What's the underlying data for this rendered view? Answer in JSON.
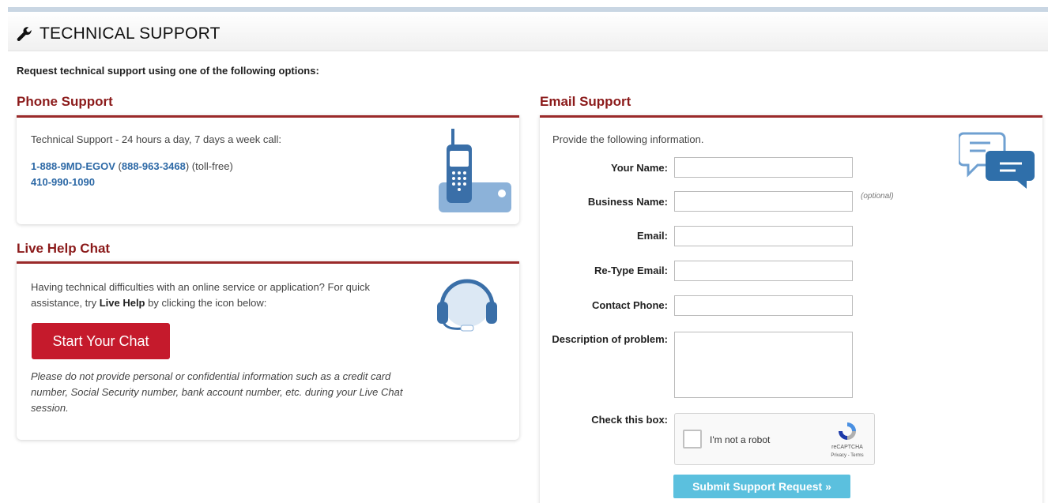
{
  "header": {
    "title": "TECHNICAL SUPPORT",
    "icon": "wrench-icon"
  },
  "intro": "Request technical support using one of the following options:",
  "phone": {
    "title": "Phone Support",
    "line1": "Technical Support - 24 hours a day, 7 days a week call:",
    "vanity_number": "1-888-9MD-EGOV",
    "paren_open": " (",
    "numeric_number": "888-963-3468",
    "paren_close": ")",
    "tollfree": " (toll-free)",
    "local_number": "410-990-1090",
    "icon": "phone-icon"
  },
  "chat": {
    "title": "Live Help Chat",
    "desc_before": "Having technical difficulties with an online service or application? For quick assistance, try ",
    "desc_bold": "Live Help",
    "desc_after": " by clicking the icon below:",
    "button": "Start Your Chat",
    "note": "Please do not provide personal or confidential information such as a credit card number, Social Security number, bank account number, etc. during your Live Chat session.",
    "icon": "headset-icon"
  },
  "email": {
    "title": "Email Support",
    "lead": "Provide the following information.",
    "labels": {
      "name": "Your Name:",
      "business": "Business Name:",
      "email": "Email:",
      "retype": "Re-Type Email:",
      "phone": "Contact Phone:",
      "description": "Description of problem:",
      "check": "Check this box:"
    },
    "optional": "(optional)",
    "captcha": {
      "label": "I'm not a robot",
      "brand": "reCAPTCHA",
      "terms": "Privacy - Terms"
    },
    "submit": "Submit Support Request »",
    "icon": "chat-bubbles-icon"
  },
  "colors": {
    "accent": "#8b1a1a",
    "chat_button": "#c51a2c",
    "submit_button": "#5bc0de",
    "link": "#2d69a6"
  }
}
